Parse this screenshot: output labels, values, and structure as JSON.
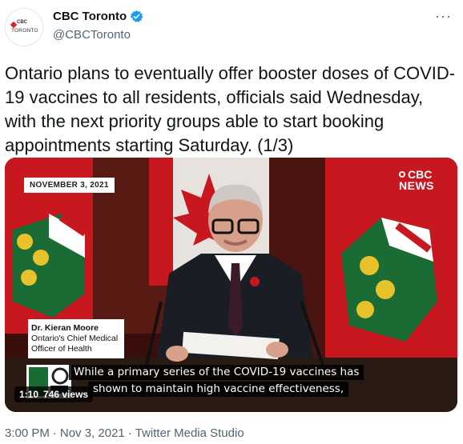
{
  "account": {
    "name": "CBC Toronto",
    "handle": "@CBCToronto",
    "avatar_top": "CBC",
    "avatar_city": "TORONTO",
    "verified_icon": "verified-badge-icon",
    "more_icon": "more-options-icon",
    "more_glyph": "···"
  },
  "tweet": {
    "text": "Ontario plans to eventually offer booster doses of COVID-19 vaccines to all residents, officials said Wednesday, with the next priority groups able to start booking appointments starting Saturday. (1/3)"
  },
  "video": {
    "date_badge": "NOVEMBER 3, 2021",
    "network_line1": "CBC",
    "network_line2": "NEWS",
    "speaker_name": "Dr. Kieran Moore",
    "speaker_title_1": "Ontario's Chief Medical",
    "speaker_title_2": "Officer of Health",
    "caption_line1": "While a primary series of the COVID-19 vaccines has",
    "caption_line2": "shown to maintain high vaccine effectiveness,",
    "duration": "1:10",
    "views": "746 views"
  },
  "meta": {
    "time": "3:00 PM",
    "separator": "·",
    "date": "Nov 3, 2021",
    "source": "Twitter Media Studio"
  },
  "colors": {
    "verified": "#1d9bf0",
    "flag_red": "#c8171e",
    "ontario_green": "#1b6b34",
    "text_secondary": "#536471"
  }
}
